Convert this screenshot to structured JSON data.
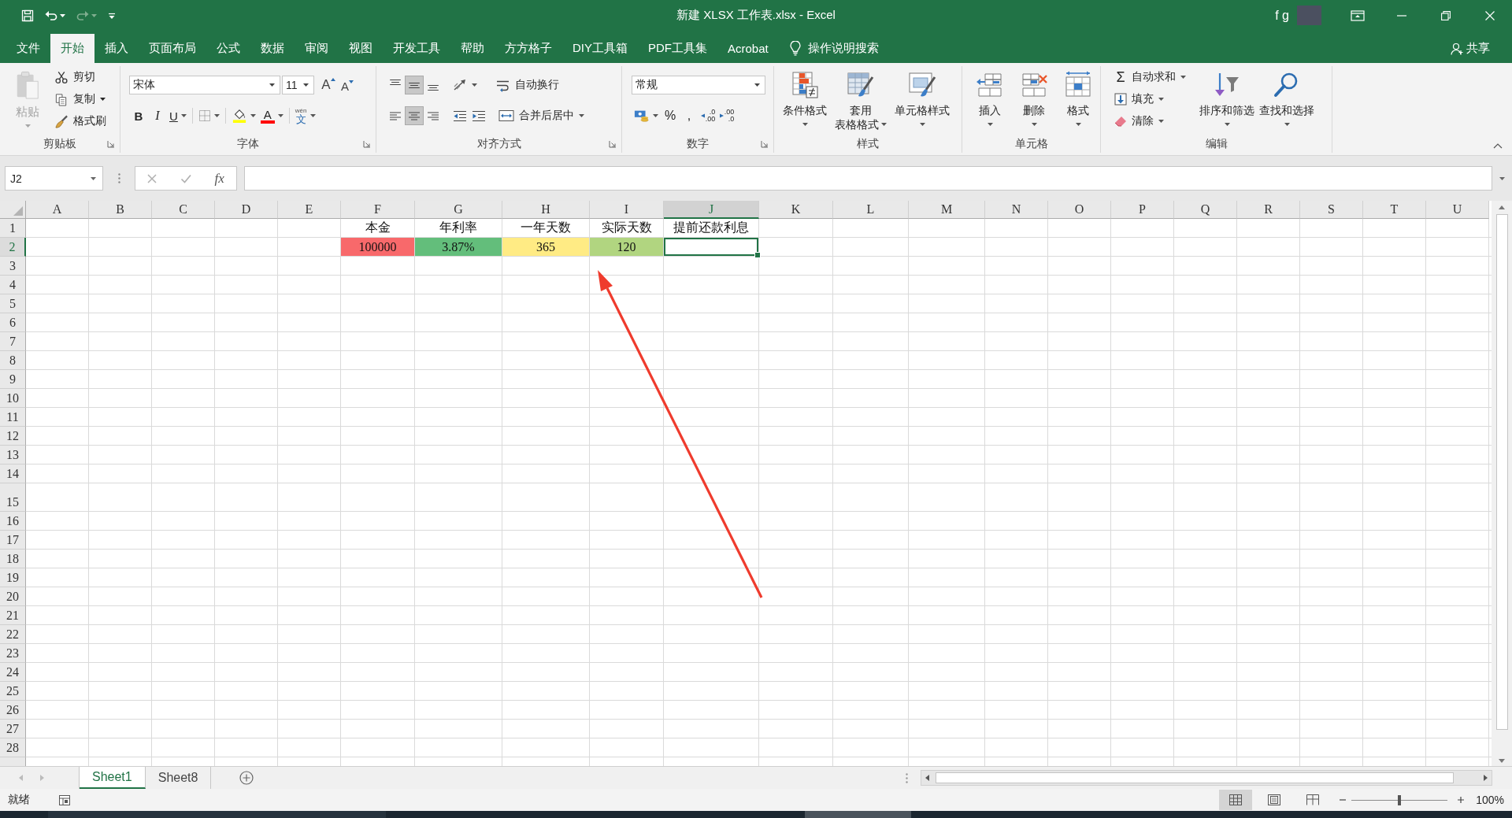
{
  "title_bar": {
    "title": "新建 XLSX 工作表.xlsx - Excel",
    "user": "f g"
  },
  "quick_access": {
    "redo": {
      "disabled": true
    }
  },
  "ribbon_tabs": [
    {
      "label": "文件",
      "selected": false
    },
    {
      "label": "开始",
      "selected": true
    },
    {
      "label": "插入",
      "selected": false
    },
    {
      "label": "页面布局",
      "selected": false
    },
    {
      "label": "公式",
      "selected": false
    },
    {
      "label": "数据",
      "selected": false
    },
    {
      "label": "审阅",
      "selected": false
    },
    {
      "label": "视图",
      "selected": false
    },
    {
      "label": "开发工具",
      "selected": false
    },
    {
      "label": "帮助",
      "selected": false
    },
    {
      "label": "方方格子",
      "selected": false
    },
    {
      "label": "DIY工具箱",
      "selected": false
    },
    {
      "label": "PDF工具集",
      "selected": false
    },
    {
      "label": "Acrobat",
      "selected": false
    }
  ],
  "tell_me": "操作说明搜索",
  "share": "共享",
  "ribbon": {
    "clipboard": {
      "label": "剪贴板",
      "paste": {
        "label": "粘贴",
        "disabled": true
      },
      "cut": "剪切",
      "copy": "复制",
      "format_painter": "格式刷"
    },
    "font": {
      "label": "字体",
      "font_name": "宋体",
      "font_size": "11",
      "grow": "A",
      "shrink": "A",
      "bold": "B",
      "italic": "I",
      "underline": "U",
      "font_color": "A",
      "phonetic": {
        "ruby": "wén",
        "char": "文"
      }
    },
    "alignment": {
      "label": "对齐方式",
      "vertical": [
        {
          "kind": "top",
          "selected": false
        },
        {
          "kind": "middle",
          "selected": true
        },
        {
          "kind": "bottom",
          "selected": false
        }
      ],
      "horizontal": [
        {
          "kind": "left",
          "selected": false
        },
        {
          "kind": "center",
          "selected": true
        },
        {
          "kind": "right",
          "selected": false
        }
      ],
      "wrap_text": "自动换行",
      "merge": "合并后居中"
    },
    "number": {
      "label": "数字",
      "format": "常规",
      "percent": "%",
      "comma": ",",
      "increase_decimal": {
        "top": ".0",
        "bottom": ".00"
      },
      "decrease_decimal": {
        "top": ".00",
        "bottom": ".0"
      }
    },
    "styles": {
      "label": "样式",
      "buttons": [
        {
          "kind": "conditional",
          "lines": [
            "条件格式"
          ]
        },
        {
          "kind": "table",
          "lines": [
            "套用",
            "表格格式"
          ]
        },
        {
          "kind": "cell_styles",
          "lines": [
            "单元格样式"
          ]
        }
      ]
    },
    "cells": {
      "label": "单元格",
      "buttons": [
        {
          "kind": "insert",
          "label": "插入"
        },
        {
          "kind": "delete",
          "label": "删除"
        },
        {
          "kind": "format",
          "label": "格式"
        }
      ]
    },
    "editing": {
      "label": "编辑",
      "small": [
        {
          "kind": "autosum",
          "symbol": "Σ",
          "label": "自动求和"
        },
        {
          "kind": "fill",
          "label": "填充"
        },
        {
          "kind": "clear",
          "label": "清除"
        }
      ],
      "sort": "排序和筛选",
      "find": "查找和选择"
    }
  },
  "formula_bar": {
    "name_box": "J2",
    "function_button": "fx"
  },
  "sheet": {
    "columns": [
      {
        "label": "A",
        "selected": false
      },
      {
        "label": "B",
        "selected": false
      },
      {
        "label": "C",
        "selected": false
      },
      {
        "label": "D",
        "selected": false
      },
      {
        "label": "E",
        "selected": false
      },
      {
        "label": "F",
        "selected": false,
        "cells": [
          {
            "text": "本金",
            "selected": false
          },
          {
            "text": "100000",
            "selected": false,
            "color": "#f8696b"
          }
        ]
      },
      {
        "label": "G",
        "selected": false,
        "cells": [
          {
            "text": "年利率",
            "selected": false
          },
          {
            "text": "3.87%",
            "selected": false,
            "color": "#63be7b"
          }
        ]
      },
      {
        "label": "H",
        "selected": false,
        "cells": [
          {
            "text": "一年天数",
            "selected": false
          },
          {
            "text": "365",
            "selected": false,
            "color": "#ffeb84"
          }
        ]
      },
      {
        "label": "I",
        "selected": false,
        "cells": [
          {
            "text": "实际天数",
            "selected": false
          },
          {
            "text": "120",
            "selected": false,
            "color": "#b1d580"
          }
        ]
      },
      {
        "label": "J",
        "selected": true,
        "cells": [
          {
            "text": "提前还款利息",
            "selected": false
          },
          {
            "selected": true
          }
        ]
      },
      {
        "label": "K",
        "selected": false
      },
      {
        "label": "L",
        "selected": false
      },
      {
        "label": "M",
        "selected": false
      },
      {
        "label": "N",
        "selected": false
      },
      {
        "label": "O",
        "selected": false
      },
      {
        "label": "P",
        "selected": false
      },
      {
        "label": "Q",
        "selected": false
      },
      {
        "label": "R",
        "selected": false
      },
      {
        "label": "S",
        "selected": false
      },
      {
        "label": "T",
        "selected": false
      },
      {
        "label": "U",
        "selected": false
      }
    ],
    "rows": [
      {
        "label": "1",
        "selected": false,
        "tall": false
      },
      {
        "label": "2",
        "selected": true,
        "tall": false
      },
      {
        "label": "3",
        "selected": false,
        "tall": false
      },
      {
        "label": "4",
        "selected": false,
        "tall": false
      },
      {
        "label": "5",
        "selected": false,
        "tall": false
      },
      {
        "label": "6",
        "selected": false,
        "tall": false
      },
      {
        "label": "7",
        "selected": false,
        "tall": false
      },
      {
        "label": "8",
        "selected": false,
        "tall": false
      },
      {
        "label": "9",
        "selected": false,
        "tall": false
      },
      {
        "label": "10",
        "selected": false,
        "tall": false
      },
      {
        "label": "11",
        "selected": false,
        "tall": false
      },
      {
        "label": "12",
        "selected": false,
        "tall": false
      },
      {
        "label": "13",
        "selected": false,
        "tall": false
      },
      {
        "label": "14",
        "selected": false,
        "tall": false
      },
      {
        "label": "15",
        "selected": false,
        "tall": true
      },
      {
        "label": "16",
        "selected": false,
        "tall": false
      },
      {
        "label": "17",
        "selected": false,
        "tall": false
      },
      {
        "label": "18",
        "selected": false,
        "tall": false
      },
      {
        "label": "19",
        "selected": false,
        "tall": false
      },
      {
        "label": "20",
        "selected": false,
        "tall": false
      },
      {
        "label": "21",
        "selected": false,
        "tall": false
      },
      {
        "label": "22",
        "selected": false,
        "tall": false
      },
      {
        "label": "23",
        "selected": false,
        "tall": false
      },
      {
        "label": "24",
        "selected": false,
        "tall": false
      },
      {
        "label": "25",
        "selected": false,
        "tall": false
      },
      {
        "label": "26",
        "selected": false,
        "tall": false
      },
      {
        "label": "27",
        "selected": false,
        "tall": false
      },
      {
        "label": "28",
        "selected": false,
        "tall": false
      }
    ]
  },
  "annotations": [
    {
      "kind": "arrow"
    }
  ],
  "sheet_tabs": [
    {
      "label": "Sheet1",
      "selected": true
    },
    {
      "label": "Sheet8",
      "selected": false
    }
  ],
  "status_bar": {
    "status": "就绪",
    "views": [
      {
        "kind": "normal",
        "selected": true
      },
      {
        "kind": "page_layout",
        "selected": false
      },
      {
        "kind": "page_break",
        "selected": false
      }
    ],
    "zoom": {
      "level": 0.5,
      "reading": "100%"
    }
  }
}
